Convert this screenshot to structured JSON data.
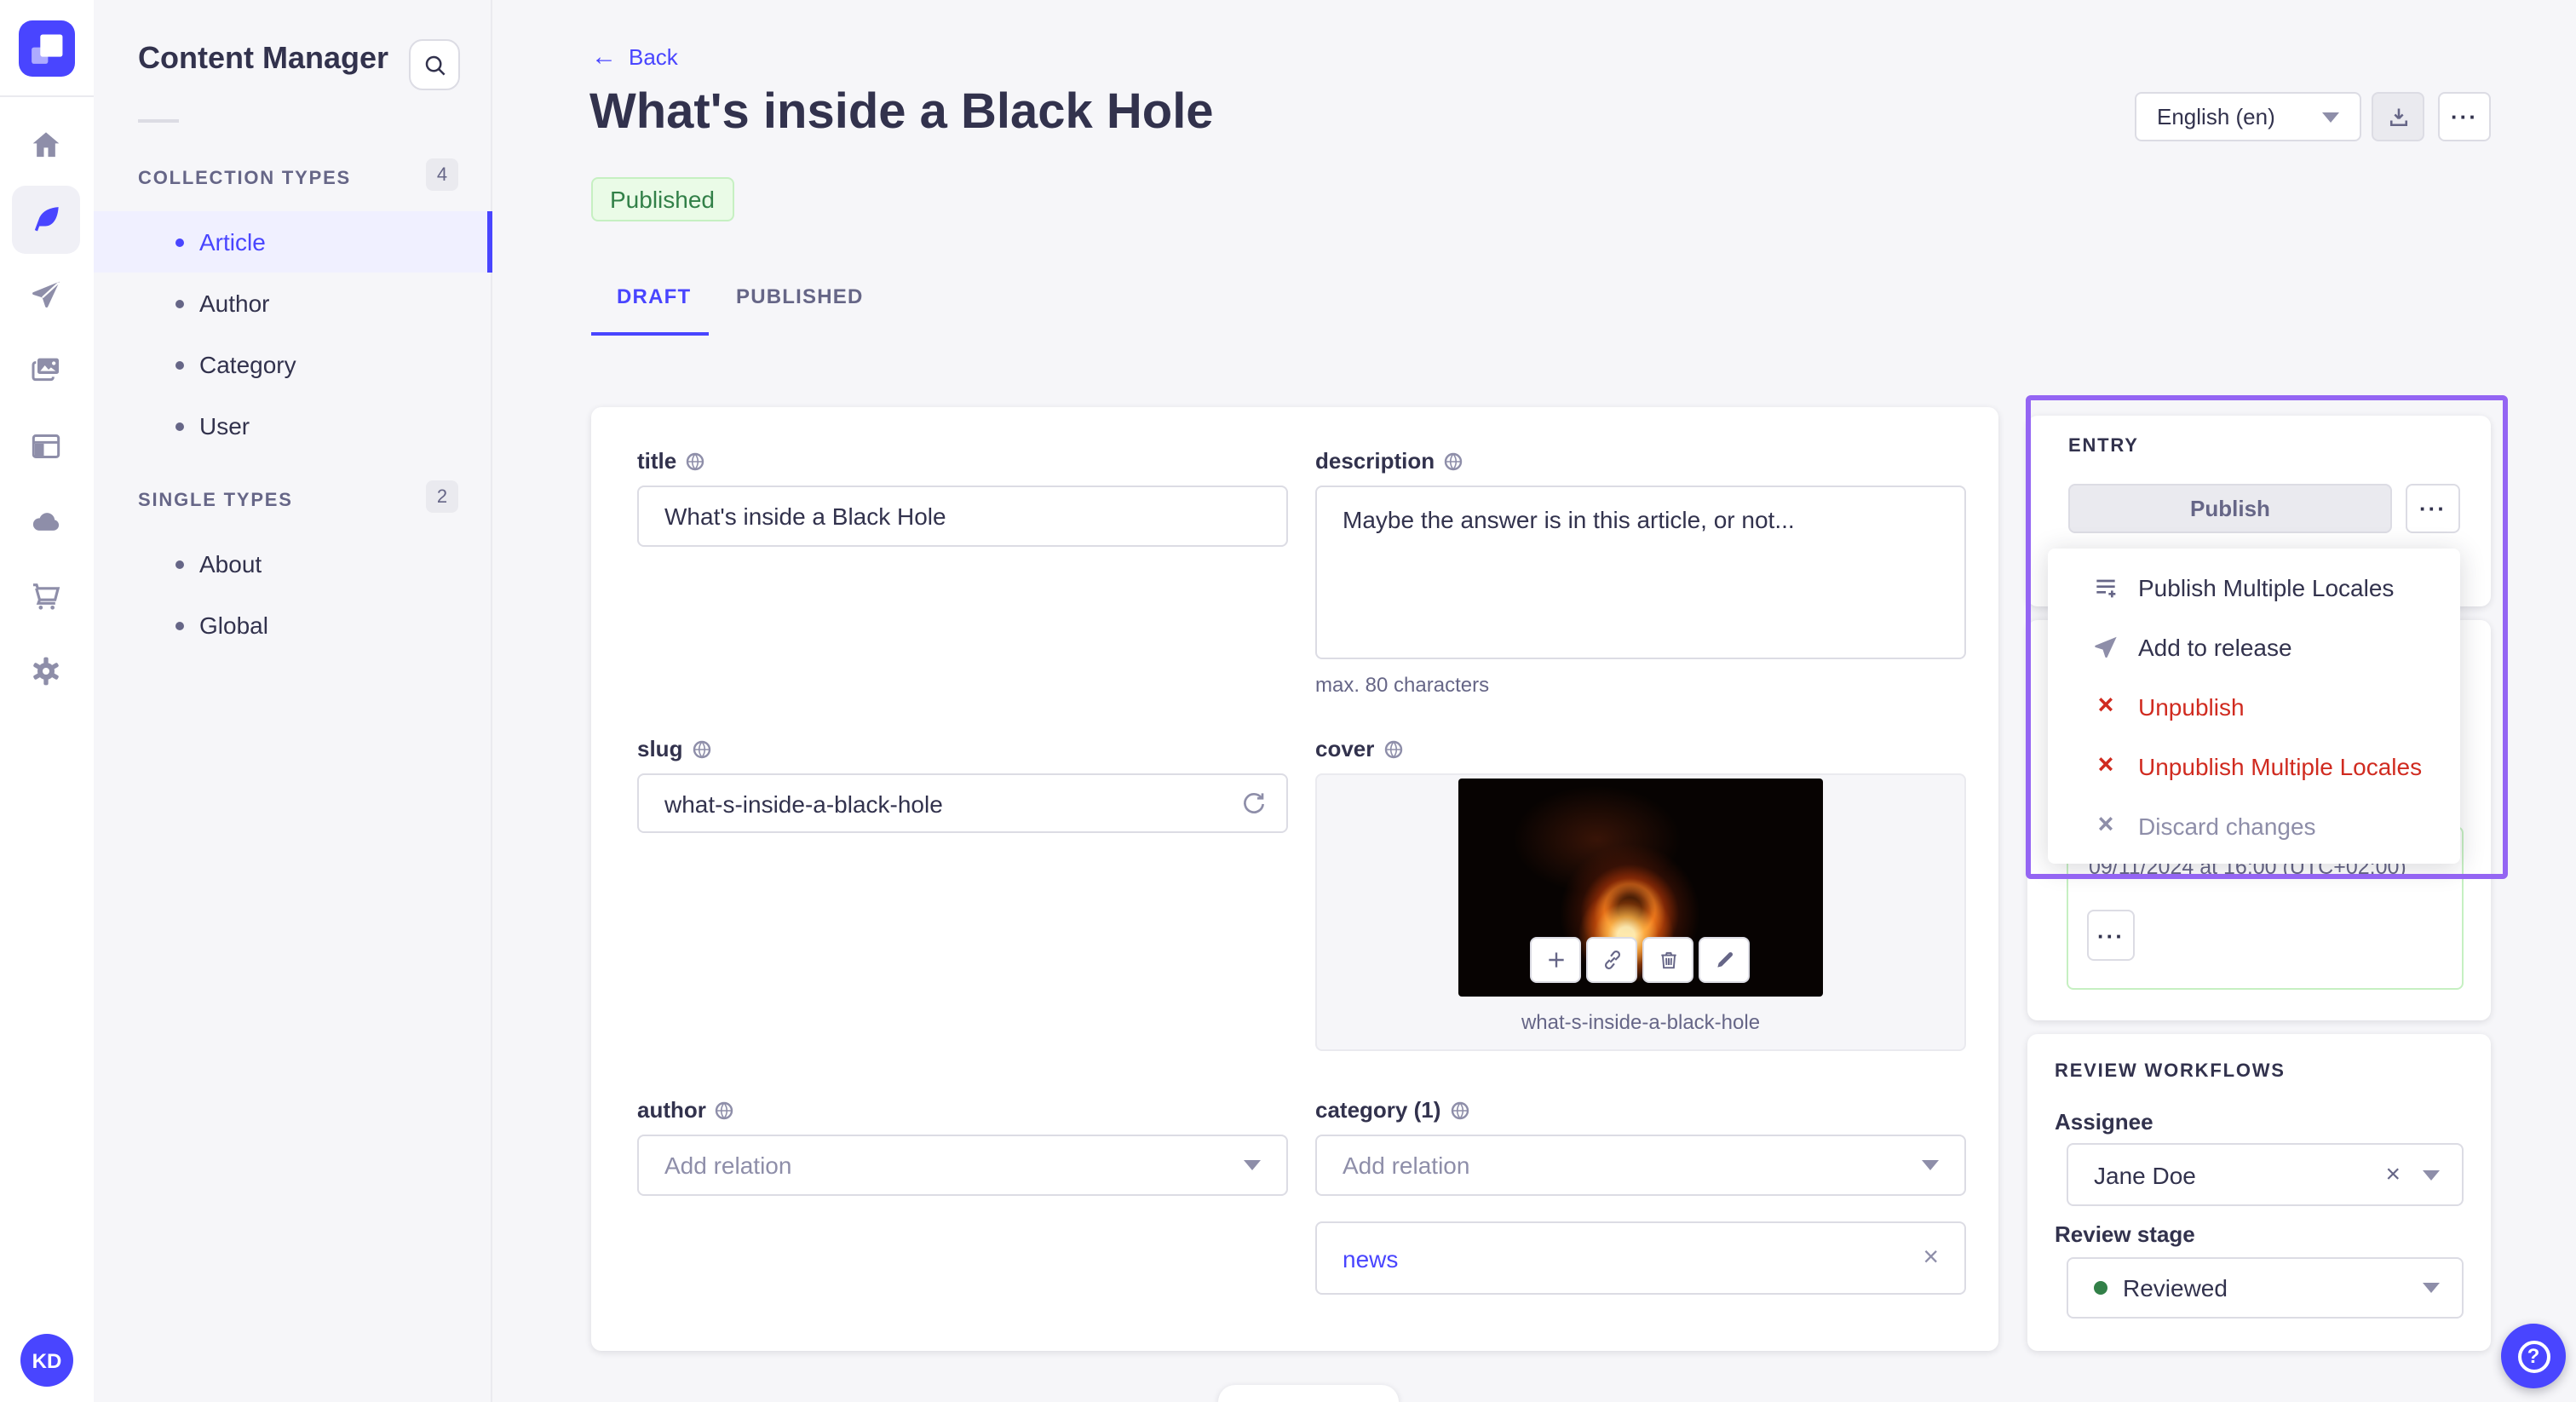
{
  "app": {
    "logo": "strapi-logo",
    "user_initials": "KD"
  },
  "panel": {
    "title": "Content Manager",
    "sections": [
      {
        "heading": "COLLECTION TYPES",
        "count": "4",
        "items": [
          "Article",
          "Author",
          "Category",
          "User"
        ]
      },
      {
        "heading": "SINGLE TYPES",
        "count": "2",
        "items": [
          "About",
          "Global"
        ]
      }
    ]
  },
  "header": {
    "back_label": "Back",
    "title": "What's inside a Black Hole",
    "status_badge": "Published",
    "tabs": [
      "DRAFT",
      "PUBLISHED"
    ],
    "locale_value": "English (en)"
  },
  "form": {
    "title": {
      "label": "title",
      "value": "What's inside a Black Hole"
    },
    "description": {
      "label": "description",
      "value": "Maybe the answer is in this article, or not...",
      "hint": "max. 80 characters"
    },
    "slug": {
      "label": "slug",
      "value": "what-s-inside-a-black-hole"
    },
    "cover": {
      "label": "cover",
      "filename": "what-s-inside-a-black-hole"
    },
    "author": {
      "label": "author",
      "placeholder": "Add relation"
    },
    "category": {
      "label": "category (1)",
      "placeholder": "Add relation",
      "relation": "news"
    }
  },
  "entry": {
    "title": "ENTRY",
    "publish_label": "Publish",
    "menu": [
      {
        "label": "Publish Multiple Locales"
      },
      {
        "label": "Add to release"
      },
      {
        "label": "Unpublish"
      },
      {
        "label": "Unpublish Multiple Locales"
      },
      {
        "label": "Discard changes"
      }
    ],
    "scheduled_date": "09/11/2024 at 16:00 (UTC+02:00)"
  },
  "review": {
    "title": "REVIEW WORKFLOWS",
    "assignee_label": "Assignee",
    "assignee_value": "Jane Doe",
    "stage_label": "Review stage",
    "stage_value": "Reviewed"
  },
  "icons": [
    "strapi-logo",
    "home-icon",
    "feather-icon",
    "paper-plane-icon",
    "media-icon",
    "layout-icon",
    "cloud-icon",
    "cart-icon",
    "gear-icon",
    "search-icon",
    "globe-icon",
    "refresh-icon",
    "plus-icon",
    "link-icon",
    "trash-icon",
    "pencil-icon",
    "download-icon",
    "more-icon",
    "close-icon",
    "list-plus-icon",
    "help-icon"
  ],
  "colors": {
    "accent": "#4945ff",
    "danger": "#d02b20",
    "success_text": "#328048",
    "success_bg": "#eafbe7",
    "success_border": "#c6f0c2",
    "selection_outline": "#9465f3",
    "text_dark": "#32324d",
    "text_muted": "#666687",
    "border": "#dcdce4",
    "page_bg": "#f6f6f9"
  }
}
